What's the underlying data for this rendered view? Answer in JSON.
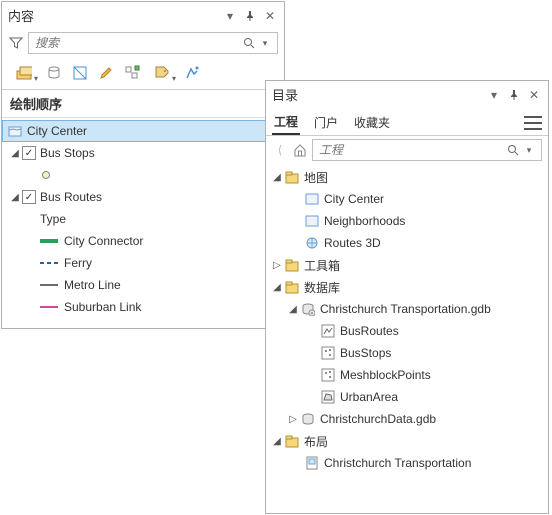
{
  "contents": {
    "title": "内容",
    "search_placeholder": "搜索",
    "section": "绘制顺序",
    "layers": {
      "city_center": "City Center",
      "bus_stops": "Bus Stops",
      "bus_routes": "Bus Routes",
      "type": "Type",
      "city_connector": "City Connector",
      "ferry": "Ferry",
      "metro_line": "Metro Line",
      "suburban_link": "Suburban Link"
    },
    "colors": {
      "city_connector": "#2e9b57",
      "ferry": "#2b5ea0",
      "metro_line": "#6a6a6a",
      "suburban_link": "#c94f9a"
    }
  },
  "catalog": {
    "title": "目录",
    "tabs": {
      "project": "工程",
      "portal": "门户",
      "favorites": "收藏夹"
    },
    "search_placeholder": "工程",
    "folders": {
      "maps": "地图",
      "toolboxes": "工具箱",
      "databases": "数据库",
      "layouts": "布局"
    },
    "maps": {
      "city_center": "City Center",
      "neighborhoods": "Neighborhoods",
      "routes_3d": "Routes 3D"
    },
    "db": {
      "transport_gdb": "Christchurch Transportation.gdb",
      "bus_routes": "BusRoutes",
      "bus_stops": "BusStops",
      "meshblock": "MeshblockPoints",
      "urban_area": "UrbanArea",
      "data_gdb": "ChristchurchData.gdb"
    },
    "layout_item": "Christchurch Transportation"
  }
}
